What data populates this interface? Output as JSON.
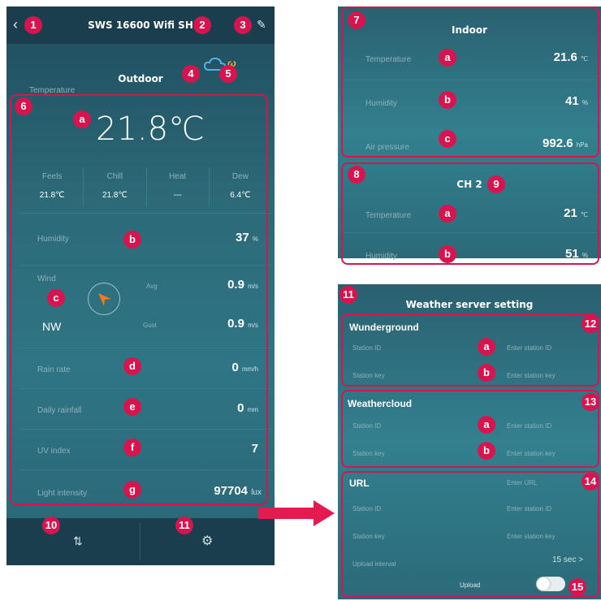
{
  "header": {
    "back_icon": "‹",
    "title": "SWS 16600 Wifi SH",
    "edit_icon": "✎"
  },
  "outdoor": {
    "title": "Outdoor",
    "temp_hint": "Temperature",
    "temperature": "21.8℃",
    "feel": [
      {
        "label": "Feels",
        "value": "21.8℃"
      },
      {
        "label": "Chill",
        "value": "21.8℃"
      },
      {
        "label": "Heat",
        "value": "---"
      },
      {
        "label": "Dew",
        "value": "6.4℃"
      }
    ],
    "humidity": {
      "label": "Humidity",
      "value": "37",
      "unit": "%"
    },
    "wind": {
      "label": "Wind",
      "direction": "NW",
      "avg_label": "Avg",
      "avg_value": "0.9",
      "gust_label": "Gust",
      "gust_value": "0.9",
      "unit": "m/s"
    },
    "rain_rate": {
      "label": "Rain rate",
      "value": "0",
      "unit": "mm/h"
    },
    "daily_rainfall": {
      "label": "Daily rainfall",
      "value": "0",
      "unit": "mm"
    },
    "uv": {
      "label": "UV index",
      "value": "7"
    },
    "light": {
      "label": "Light intensity",
      "value": "97704",
      "unit": "lux"
    }
  },
  "indoor": {
    "title": "Indoor",
    "temperature": {
      "label": "Temperature",
      "value": "21.6",
      "unit": "℃"
    },
    "humidity": {
      "label": "Humidity",
      "value": "41",
      "unit": "%"
    },
    "pressure": {
      "label": "Air pressure",
      "value": "992.6",
      "unit": "hPa"
    }
  },
  "ch2": {
    "title": "CH 2",
    "temperature": {
      "label": "Temperature",
      "value": "21",
      "unit": "℃"
    },
    "humidity": {
      "label": "Humidity",
      "value": "51",
      "unit": "%"
    }
  },
  "server": {
    "title": "Weather server setting",
    "wunderground": {
      "name": "Wunderground",
      "id_label": "Station ID",
      "id_placeholder": "Enter station ID",
      "key_label": "Station key",
      "key_placeholder": "Enter station key"
    },
    "weathercloud": {
      "name": "Weathercloud",
      "id_label": "Station ID",
      "id_placeholder": "Enter station ID",
      "key_label": "Station key",
      "key_placeholder": "Enter station key"
    },
    "url": {
      "name": "URL",
      "url_placeholder": "Enter URL",
      "id_label": "Station ID",
      "id_placeholder": "Enter station ID",
      "key_label": "Station key",
      "key_placeholder": "Enter station key",
      "interval_label": "Upload interval",
      "interval_value": "15 sec >",
      "upload_label": "Upload"
    }
  },
  "badges": {
    "b1": "1",
    "b2": "2",
    "b3": "3",
    "b4": "4",
    "b5": "5",
    "b6": "6",
    "b7": "7",
    "b8": "8",
    "b9": "9",
    "b10": "10",
    "b11": "11",
    "b12": "12",
    "b13": "13",
    "b14": "14",
    "b15": "15",
    "a": "a",
    "b": "b",
    "c": "c",
    "d": "d",
    "e": "e",
    "f": "f",
    "g": "g"
  },
  "colors": {
    "badge": "#d6154f",
    "arrow": "#e31b4f",
    "compass_needle": "#f07b1d"
  }
}
